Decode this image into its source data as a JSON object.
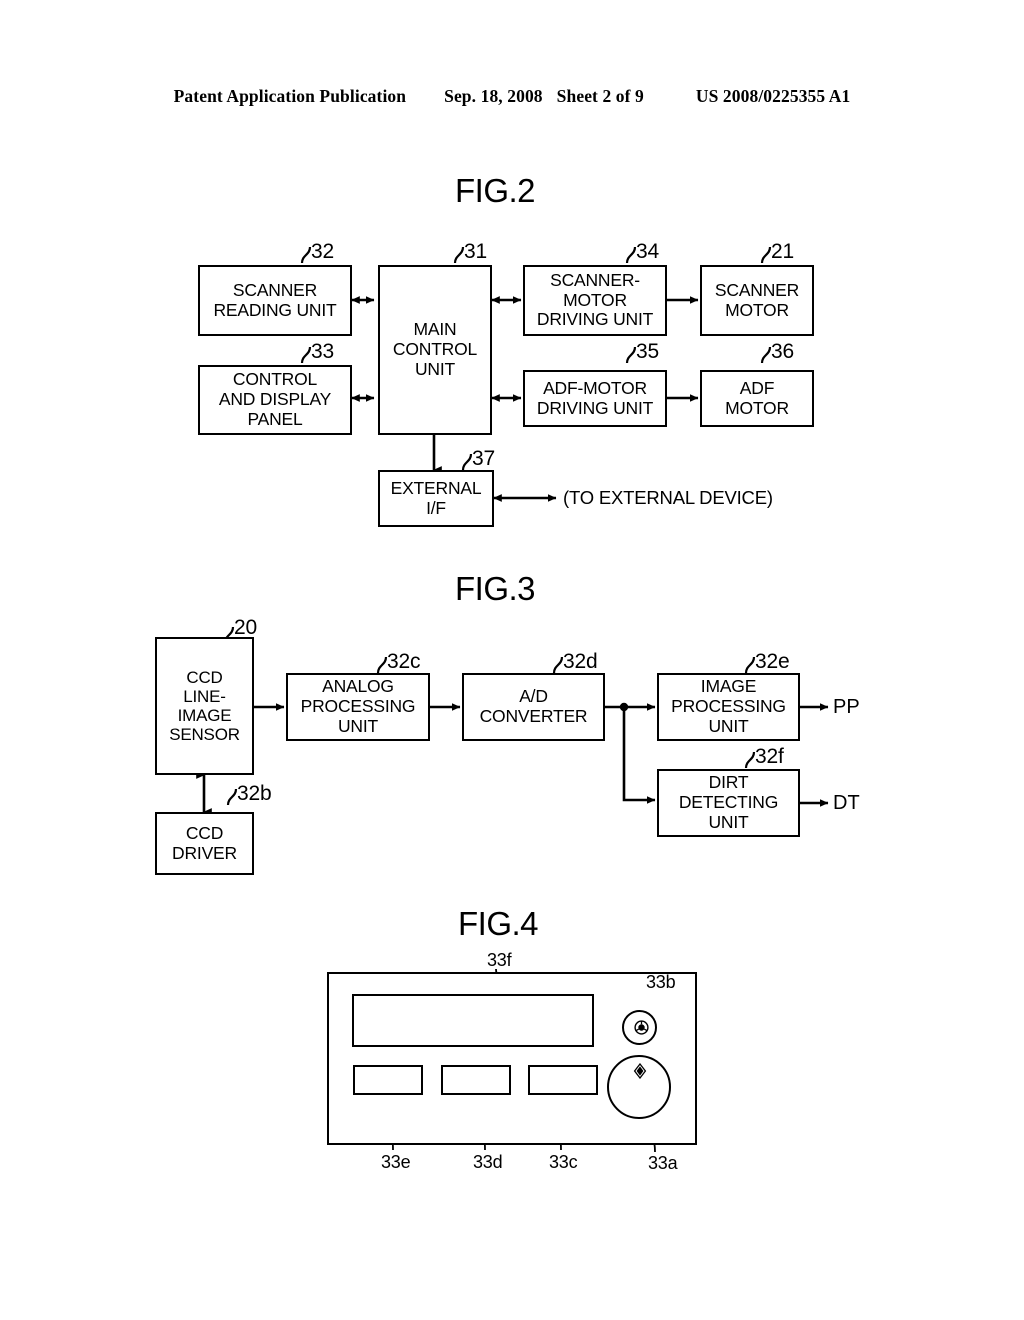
{
  "header": {
    "publication": "Patent Application Publication",
    "date": "Sep. 18, 2008",
    "sheet": "Sheet 2 of 9",
    "patent_number": "US 2008/0225355 A1"
  },
  "figures": {
    "fig2": {
      "title": "FIG.2",
      "blocks": [
        {
          "id": "scanner-reading-unit",
          "label": "SCANNER\nREADING UNIT",
          "ref": "32"
        },
        {
          "id": "control-and-display-panel",
          "label": "CONTROL\nAND DISPLAY\nPANEL",
          "ref": "33"
        },
        {
          "id": "main-control-unit",
          "label": "MAIN\nCONTROL\nUNIT",
          "ref": "31"
        },
        {
          "id": "scanner-motor-driving-unit",
          "label": "SCANNER-\nMOTOR\nDRIVING UNIT",
          "ref": "34"
        },
        {
          "id": "scanner-motor",
          "label": "SCANNER\nMOTOR",
          "ref": "21"
        },
        {
          "id": "adf-motor-driving-unit",
          "label": "ADF-MOTOR\nDRIVING UNIT",
          "ref": "35"
        },
        {
          "id": "adf-motor",
          "label": "ADF\nMOTOR",
          "ref": "36"
        },
        {
          "id": "external-if",
          "label": "EXTERNAL\nI/F",
          "ref": "37"
        }
      ],
      "annotations": [
        {
          "id": "to-external-device",
          "text": "(TO EXTERNAL DEVICE)"
        }
      ]
    },
    "fig3": {
      "title": "FIG.3",
      "blocks": [
        {
          "id": "ccd-line-image-sensor",
          "label": "CCD\nLINE-\nIMAGE\nSENSOR",
          "ref": "20"
        },
        {
          "id": "ccd-driver",
          "label": "CCD\nDRIVER",
          "ref": "32b"
        },
        {
          "id": "analog-processing-unit",
          "label": "ANALOG\nPROCESSING\nUNIT",
          "ref": "32c"
        },
        {
          "id": "ad-converter",
          "label": "A/D\nCONVERTER",
          "ref": "32d"
        },
        {
          "id": "image-processing-unit",
          "label": "IMAGE\nPROCESSING\nUNIT",
          "ref": "32e"
        },
        {
          "id": "dirt-detecting-unit",
          "label": "DIRT\nDETECTING\nUNIT",
          "ref": "32f"
        }
      ],
      "outputs": [
        {
          "id": "output-pp",
          "text": "PP"
        },
        {
          "id": "output-dt",
          "text": "DT"
        }
      ]
    },
    "fig4": {
      "title": "FIG.4",
      "refs": [
        {
          "id": "display-33f",
          "text": "33f"
        },
        {
          "id": "stop-button-33b",
          "text": "33b"
        },
        {
          "id": "start-button-33a",
          "text": "33a"
        },
        {
          "id": "key-33c",
          "text": "33c"
        },
        {
          "id": "key-33d",
          "text": "33d"
        },
        {
          "id": "key-33e",
          "text": "33e"
        }
      ],
      "icons": {
        "stop": "stop-icon",
        "start": "start-icon"
      }
    }
  },
  "colors": {
    "line": "#000000",
    "background": "#ffffff"
  }
}
